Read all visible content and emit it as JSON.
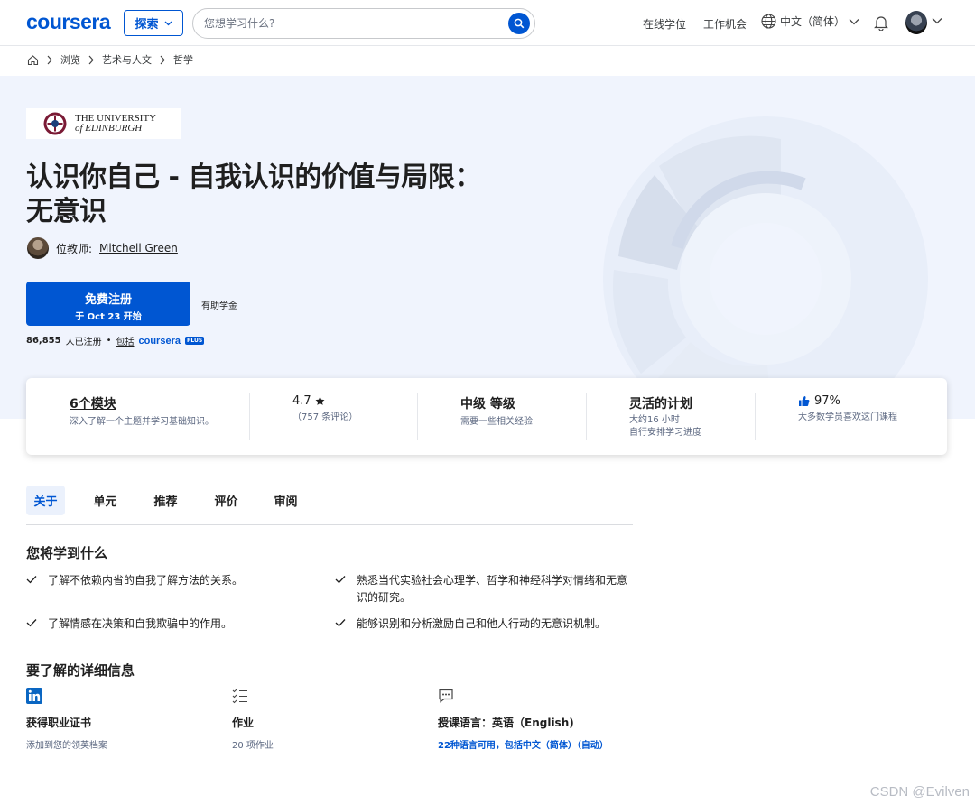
{
  "topnav": {
    "logo": "coursera",
    "explore_label": "探索",
    "search_placeholder": "您想学习什么?",
    "links": [
      "在线学位",
      "工作机会"
    ],
    "language": "中文（简体）"
  },
  "breadcrumb": [
    "浏览",
    "艺术与人文",
    "哲学"
  ],
  "hero": {
    "university_line1": "THE UNIVERSITY",
    "university_line2": "of EDINBURGH",
    "title_line1": "认识你自己 - 自我认识的价值与局限：",
    "title_line2": "无意识",
    "instructor_label": "位教师:",
    "instructor_name": "Mitchell Green",
    "enroll_main": "免费注册",
    "enroll_sub": "于 Oct 23 开始",
    "financial_aid": "有助学金",
    "enrolled_count": "86,855",
    "enrolled_suffix": "人已注册",
    "bullet": "•",
    "included": "包括",
    "plus_logo": "coursera",
    "plus_badge": "PLUS"
  },
  "info_card": [
    {
      "title": "6个模块",
      "sub": "深入了解一个主题并学习基础知识。"
    },
    {
      "title": "4.7",
      "sub": "（757 条评论）"
    },
    {
      "title": "中级 等级",
      "sub": "需要一些相关经验"
    },
    {
      "title": "灵活的计划",
      "sub": "大约16 小时",
      "sub2": "自行安排学习进度"
    },
    {
      "title": "97%",
      "sub": "大多数学员喜欢这门课程"
    }
  ],
  "tabs": [
    "关于",
    "单元",
    "推荐",
    "评价",
    "审阅"
  ],
  "learn": {
    "title": "您将学到什么",
    "items": [
      "了解不依赖内省的自我了解方法的关系。",
      "熟悉当代实验社会心理学、哲学和神经科学对情绪和无意识的研究。",
      "了解情感在决策和自我欺骗中的作用。",
      "能够识别和分析激励自己和他人行动的无意识机制。"
    ]
  },
  "details": {
    "title": "要了解的详细信息",
    "items": [
      {
        "title": "获得职业证书",
        "sub": "添加到您的领英档案"
      },
      {
        "title": "作业",
        "sub": "20 项作业"
      },
      {
        "title": "授课语言：英语（English)",
        "sub": "22种语言可用，包括中文（简体）（自动）"
      }
    ]
  },
  "watermark": "CSDN @Evilven",
  "colors": {
    "brand": "#0056d2",
    "hero_bg": "#f0f4fd"
  }
}
